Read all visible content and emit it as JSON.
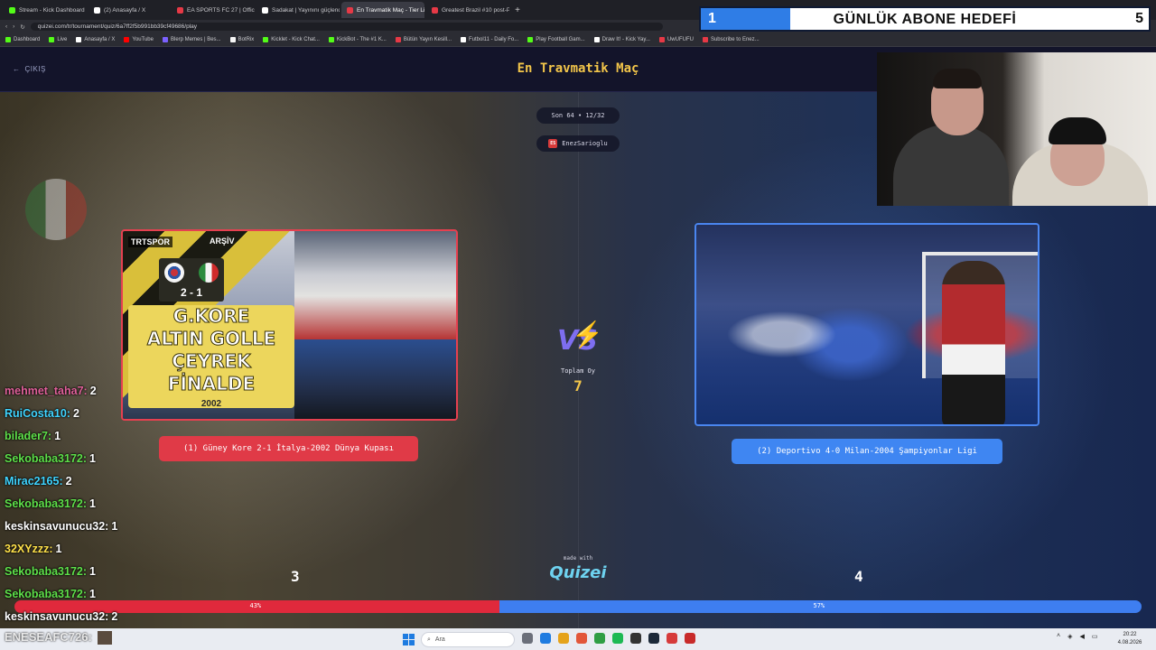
{
  "browser": {
    "tabs": [
      {
        "label": "Stream - Kick Dashboard",
        "color": "#53fc18",
        "active": false
      },
      {
        "label": "(2) Anasayfa / X",
        "color": "#ffffff",
        "active": false
      },
      {
        "label": "EA SPORTS FC 27 | Officia",
        "color": "#e63946",
        "active": false
      },
      {
        "label": "Sadakat | Yayınını güçlendi",
        "color": "#ffffff",
        "active": false
      },
      {
        "label": "En Travmatik Maç - Tier Li",
        "color": "#e63946",
        "active": true
      },
      {
        "label": "Greatest Brazil #10 post-Pe",
        "color": "#e63946",
        "active": false
      }
    ],
    "new_tab": "+",
    "url": "quizei.com/tr/tournament/quiz/6a7ff2f5b991bb39cf49686/play",
    "bookmarks": [
      {
        "label": "Dashboard",
        "color": "#53fc18"
      },
      {
        "label": "Live",
        "color": "#53fc18"
      },
      {
        "label": "Anasayfa / X",
        "color": "#ffffff"
      },
      {
        "label": "YouTube",
        "color": "#ff0000"
      },
      {
        "label": "Blerp Memes | Bes...",
        "color": "#7b61ff"
      },
      {
        "label": "BotRix",
        "color": "#f5f5f5"
      },
      {
        "label": "Kicklet - Kick Chat...",
        "color": "#53fc18"
      },
      {
        "label": "KickBot - The #1 K...",
        "color": "#53fc18"
      },
      {
        "label": "Bütün Yayın Kesill...",
        "color": "#e63946"
      },
      {
        "label": "Futbol11 - Daily Fo...",
        "color": "#ffffff"
      },
      {
        "label": "Play Football Gam...",
        "color": "#53fc18"
      },
      {
        "label": "Draw It! - Kick Yay...",
        "color": "#ffffff"
      },
      {
        "label": "UwUFUFU",
        "color": "#e63946"
      },
      {
        "label": "Subscribe to Enez...",
        "color": "#e63946"
      }
    ]
  },
  "quiz": {
    "back_label": "ÇIKIŞ",
    "title": "En Travmatik Maç",
    "round": "Son 64 • 12/32",
    "creator_initials": "ES",
    "creator": "EnezSarioglu",
    "total_label": "Toplam Oy",
    "total_votes": "7",
    "made_with": "made with",
    "brand": "Quizei",
    "left": {
      "badge_channel": "TRTSPOR",
      "badge_archive": "ARŞİV",
      "score": "2 - 1",
      "headline": [
        "G.KORE",
        "ALTIN GOLLE",
        "ÇEYREK FİNALDE"
      ],
      "year": "2002",
      "label": "(1) Güney Kore 2-1 İtalya-2002 Dünya Kupası",
      "votes": "3",
      "percent_text": "43%",
      "percent": 0.43
    },
    "right": {
      "label": "(2) Deportivo 4-0 Milan-2004 Şampiyonlar Ligi",
      "votes": "4",
      "percent_text": "57%",
      "percent": 0.57
    }
  },
  "goal_overlay": {
    "current": "1",
    "title": "GÜNLÜK ABONE HEDEFİ",
    "target": "5",
    "progress": 0.2
  },
  "chat": [
    {
      "user": "mehmet_taha7:",
      "value": "2",
      "color": "#e0609a"
    },
    {
      "user": "RuiCosta10:",
      "value": "2",
      "color": "#3fd4ff"
    },
    {
      "user": "bilader7:",
      "value": "1",
      "color": "#5ee04a"
    },
    {
      "user": "Sekobaba3172:",
      "value": "1",
      "color": "#5ee04a"
    },
    {
      "user": "Mirac2165:",
      "value": "2",
      "color": "#3fd4ff"
    },
    {
      "user": "Sekobaba3172:",
      "value": "1",
      "color": "#5ee04a"
    },
    {
      "user": "keskinsavunucu32:",
      "value": "1",
      "color": "#ffffff"
    },
    {
      "user": "32XYzzz:",
      "value": "1",
      "color": "#ffe14a"
    },
    {
      "user": "Sekobaba3172:",
      "value": "1",
      "color": "#5ee04a"
    },
    {
      "user": "Sekobaba3172:",
      "value": "1",
      "color": "#5ee04a"
    },
    {
      "user": "keskinsavunucu32:",
      "value": "2",
      "color": "#ffffff"
    }
  ],
  "streamer": {
    "name": "ENESEAFC726:"
  },
  "taskbar": {
    "search_placeholder": "Ara",
    "time": "20:22",
    "date": "4.08.2026"
  }
}
